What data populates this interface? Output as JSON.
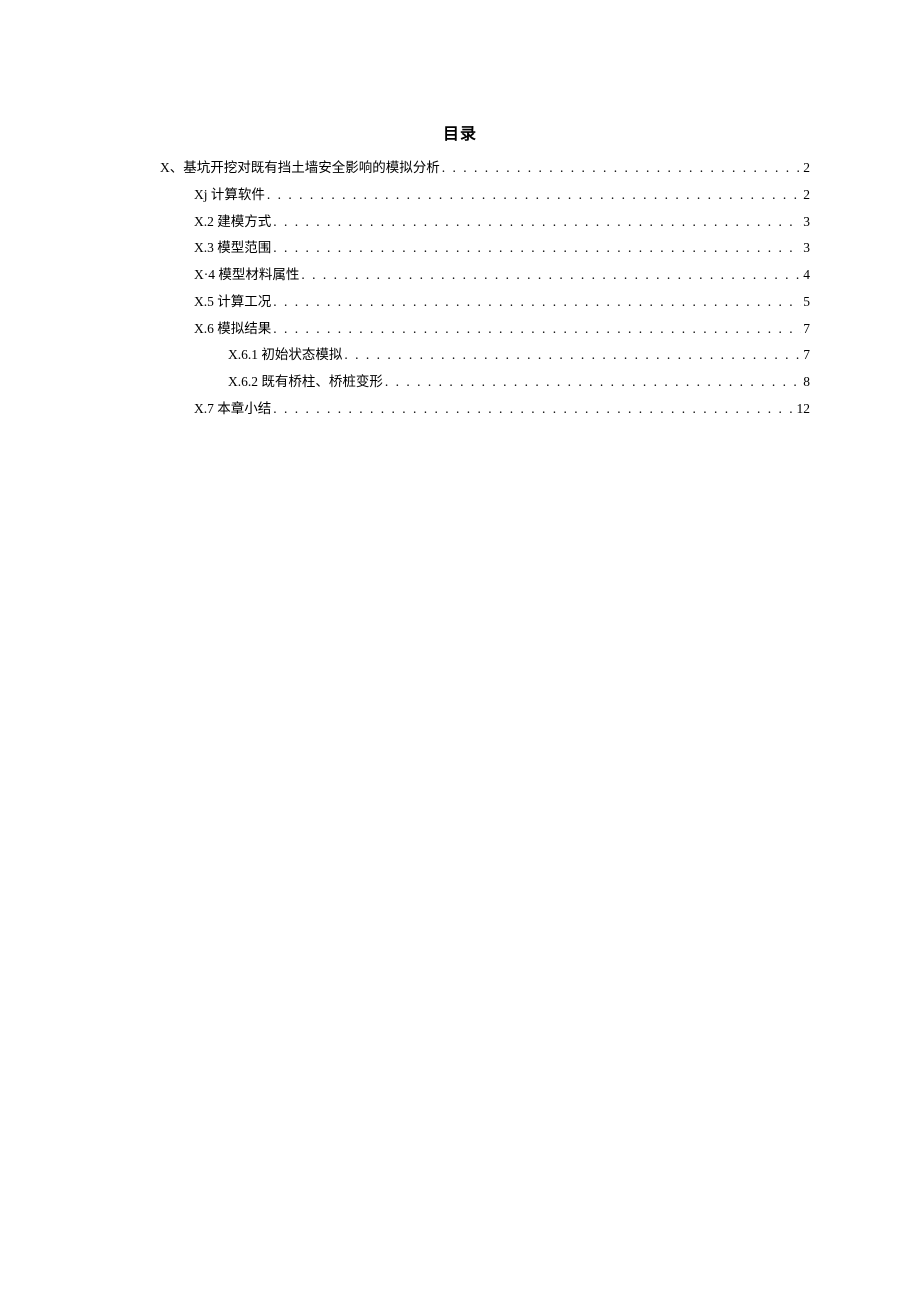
{
  "title": "目录",
  "toc": [
    {
      "level": 1,
      "num": "X、",
      "text": "基坑开挖对既有挡土墙安全影响的模拟分析",
      "page": "2"
    },
    {
      "level": 2,
      "num": "Xj",
      "text": " 计算软件",
      "page": "2"
    },
    {
      "level": 2,
      "num": "X.2",
      "text": " 建模方式",
      "page": "3"
    },
    {
      "level": 2,
      "num": "X.3",
      "text": " 模型范围",
      "page": "3"
    },
    {
      "level": 2,
      "num": "X·4",
      "text": " 模型材料属性",
      "page": "4"
    },
    {
      "level": 2,
      "num": "X.5",
      "text": " 计算工况",
      "page": "5"
    },
    {
      "level": 2,
      "num": "X.6",
      "text": " 模拟结果",
      "page": "7"
    },
    {
      "level": 3,
      "num": "X.6.1",
      "text": " 初始状态模拟",
      "page": "7"
    },
    {
      "level": 3,
      "num": "X.6.2",
      "text": " 既有桥柱、桥桩变形",
      "page": "8"
    },
    {
      "level": 2,
      "num": "X.7",
      "text": " 本章小结",
      "page": "12"
    }
  ]
}
